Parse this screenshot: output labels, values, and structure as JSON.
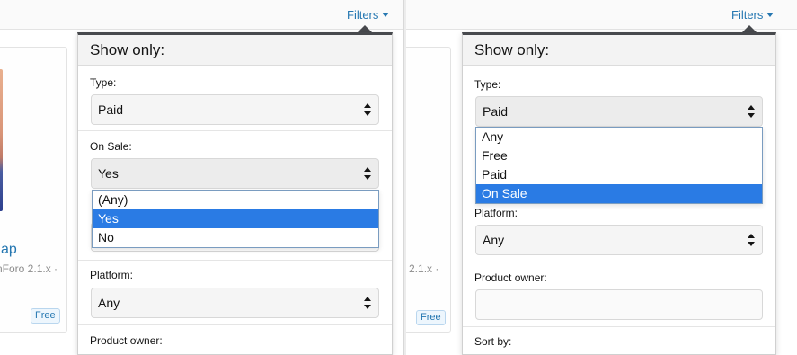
{
  "filters_link": "Filters",
  "left": {
    "background": {
      "title_fragment": "ap",
      "subtitle_fragment": "nForo 2.1.x ·",
      "badge": "Free"
    },
    "popup": {
      "header": "Show only:",
      "type": {
        "label": "Type:",
        "value": "Paid"
      },
      "on_sale": {
        "label": "On Sale:",
        "value": "Yes",
        "options": [
          "(Any)",
          "Yes",
          "No"
        ],
        "highlighted": "Yes"
      },
      "platform": {
        "label": "Platform:",
        "value": "Any"
      },
      "product_owner": {
        "label": "Product owner:"
      }
    }
  },
  "right": {
    "background": {
      "subtitle_fragment": "o 2.1.x ·",
      "badge": "Free"
    },
    "popup": {
      "header": "Show only:",
      "type": {
        "label": "Type:",
        "value": "Paid",
        "options": [
          "Any",
          "Free",
          "Paid",
          "On Sale"
        ],
        "highlighted": "On Sale"
      },
      "platform": {
        "label": "Platform:",
        "value": "Any"
      },
      "product_owner": {
        "label": "Product owner:",
        "value": ""
      },
      "sort_by": {
        "label": "Sort by:"
      }
    }
  },
  "colors": {
    "link": "#2577b1",
    "highlight": "#2a7be4",
    "popup_border_top": "#47494d"
  }
}
